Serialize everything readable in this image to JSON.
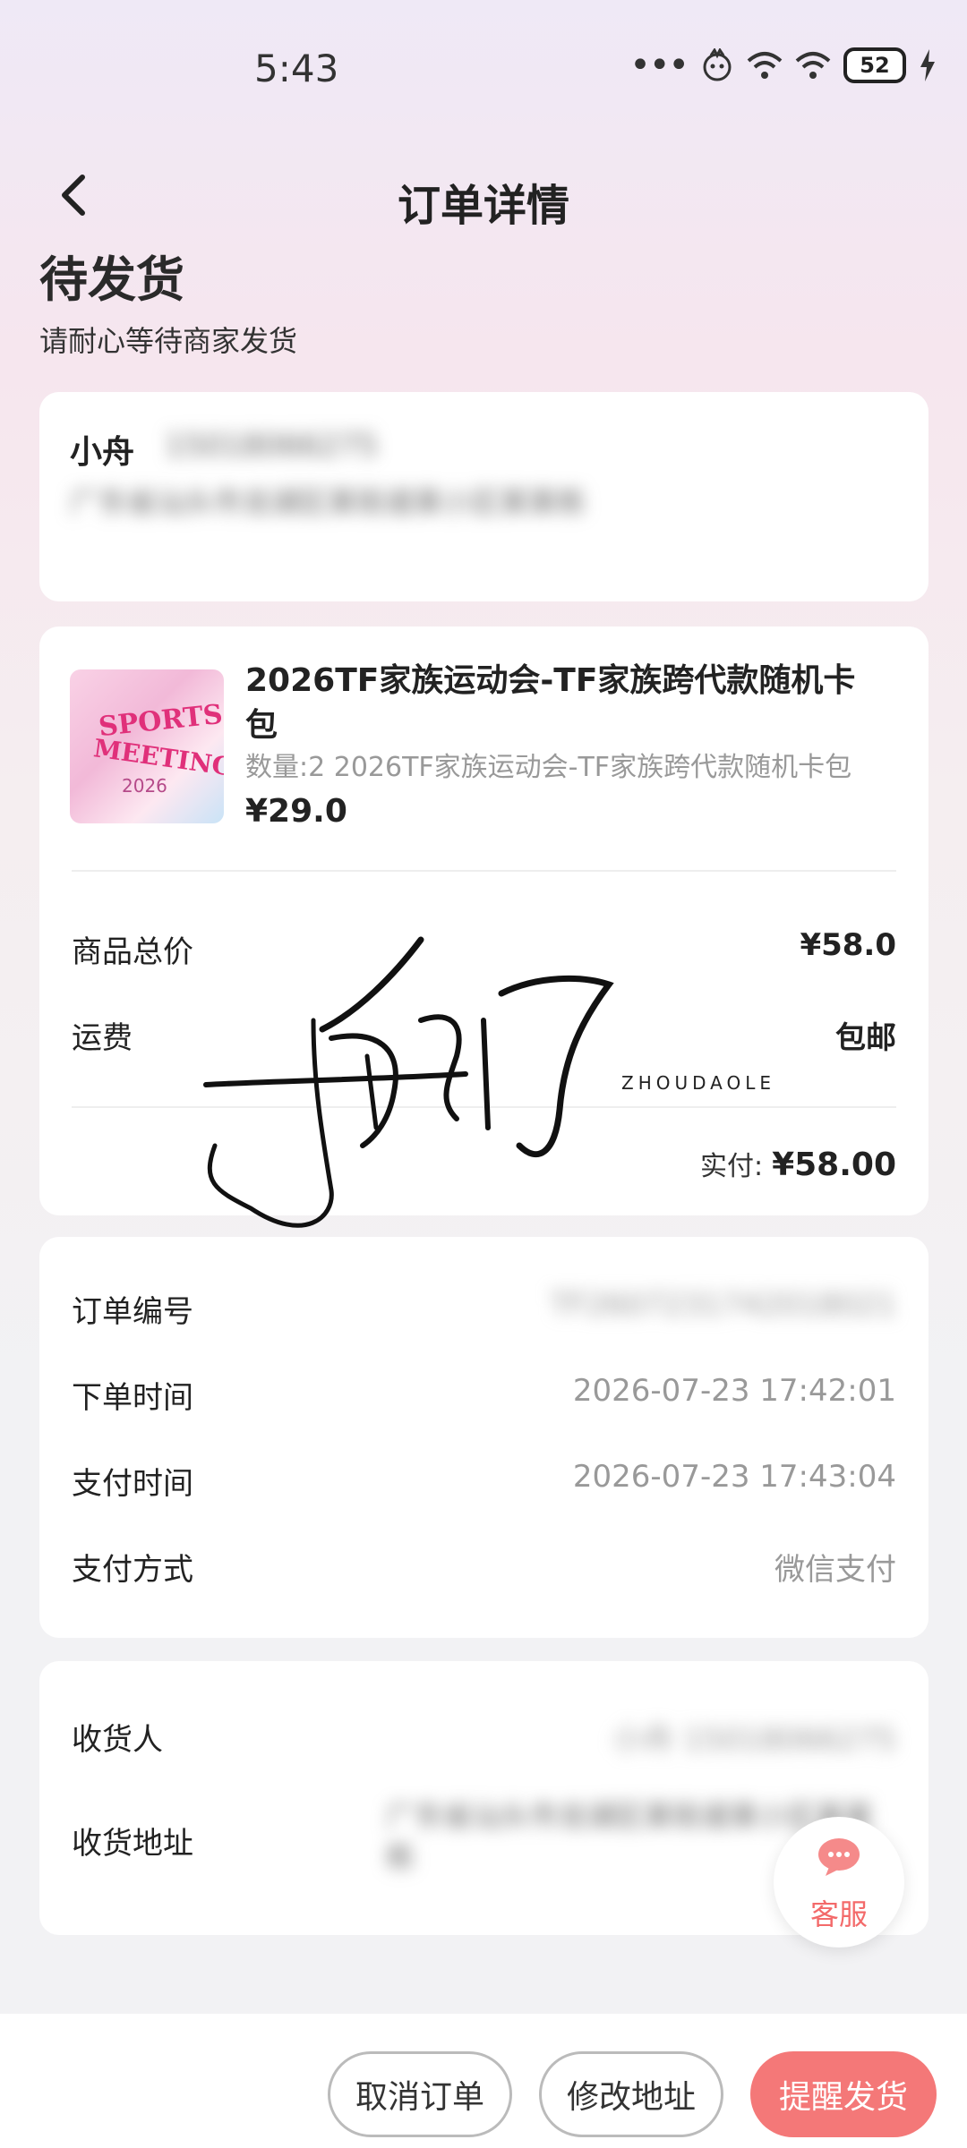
{
  "status_bar": {
    "time": "5:43",
    "battery": "52"
  },
  "header": {
    "title": "订单详情"
  },
  "order_status": {
    "title": "待发货",
    "subtitle": "请耐心等待商家发货"
  },
  "address_card": {
    "name": "小舟",
    "phone": "15018066275",
    "address": "广东省汕头市龙湖区某街道某小区某某栋"
  },
  "product": {
    "thumb_text_1": "SPORTS",
    "thumb_text_2": "MEETING",
    "thumb_text_3": "2026",
    "name": "2026TF家族运动会-TF家族跨代款随机卡包",
    "desc": "数量:2 2026TF家族运动会-TF家族跨代款随机卡包",
    "price": "¥29.0"
  },
  "price_summary": {
    "goods_label": "商品总价",
    "goods_value": "¥58.0",
    "shipping_label": "运费",
    "shipping_value": "包邮",
    "paid_label": "实付:",
    "paid_value": "¥58.00"
  },
  "order_info": {
    "number_label": "订单编号",
    "number_value": "TF2607231742018021",
    "created_label": "下单时间",
    "created_value": "2026-07-23 17:42:01",
    "paid_time_label": "支付时间",
    "paid_time_value": "2026-07-23 17:43:04",
    "method_label": "支付方式",
    "method_value": "微信支付"
  },
  "receiver": {
    "receiver_label": "收货人",
    "receiver_value": "小舟 15018066275",
    "address_label": "收货地址",
    "address_value": "广东省汕头市龙湖区某街道某小区某某栋"
  },
  "watermark": {
    "text": "ZHOUDAOLE",
    "signature": "舟到了"
  },
  "customer_service": {
    "label": "客服"
  },
  "actions": {
    "cancel": "取消订单",
    "modify": "修改地址",
    "remind": "提醒发货"
  },
  "colors": {
    "accent": "#f47878",
    "cs_text": "#f36a6a"
  }
}
